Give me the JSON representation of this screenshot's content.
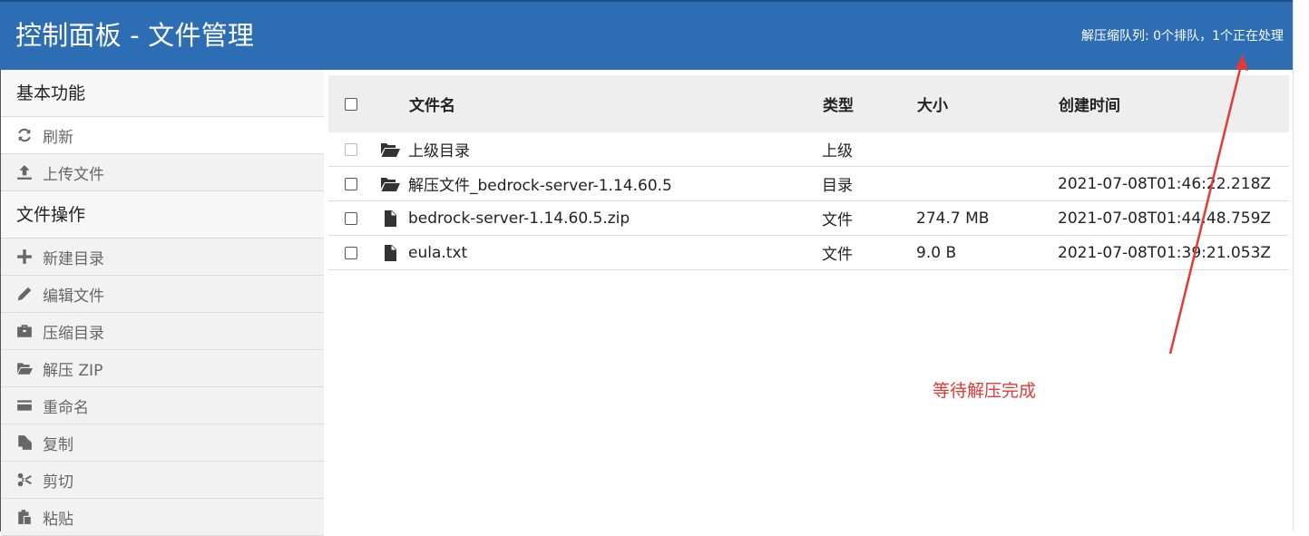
{
  "header": {
    "title": "控制面板 - 文件管理",
    "queue_status": "解压缩队列: 0个排队，1个正在处理"
  },
  "sidebar": {
    "section1_title": "基本功能",
    "section1_items": [
      {
        "label": "刷新",
        "icon": "refresh-icon"
      },
      {
        "label": "上传文件",
        "icon": "upload-icon"
      }
    ],
    "section2_title": "文件操作",
    "section2_items": [
      {
        "label": "新建目录",
        "icon": "plus-icon"
      },
      {
        "label": "编辑文件",
        "icon": "pencil-icon"
      },
      {
        "label": "压缩目录",
        "icon": "briefcase-icon"
      },
      {
        "label": "解压 ZIP",
        "icon": "folder-open-icon"
      },
      {
        "label": "重命名",
        "icon": "card-icon"
      },
      {
        "label": "复制",
        "icon": "copy-icon"
      },
      {
        "label": "剪切",
        "icon": "scissors-icon"
      },
      {
        "label": "粘贴",
        "icon": "clipboard-icon"
      }
    ]
  },
  "table": {
    "headers": {
      "name": "文件名",
      "type": "类型",
      "size": "大小",
      "created": "创建时间"
    },
    "rows": [
      {
        "icon": "folder-open-icon",
        "name": "上级目录",
        "type": "上级",
        "size": "",
        "created": ""
      },
      {
        "icon": "folder-open-icon",
        "name": "解压文件_bedrock-server-1.14.60.5",
        "type": "目录",
        "size": "",
        "created": "2021-07-08T01:46:22.218Z"
      },
      {
        "icon": "file-icon",
        "name": "bedrock-server-1.14.60.5.zip",
        "type": "文件",
        "size": "274.7 MB",
        "created": "2021-07-08T01:44:48.759Z"
      },
      {
        "icon": "file-icon",
        "name": "eula.txt",
        "type": "文件",
        "size": "9.0 B",
        "created": "2021-07-08T01:39:21.053Z"
      }
    ]
  },
  "annotation": {
    "text": "等待解压完成",
    "color": "#e53935"
  },
  "colors": {
    "header_bg": "#2c6db4",
    "sidebar_bg": "#f2f2f2",
    "table_header_bg": "#eeeeee"
  }
}
